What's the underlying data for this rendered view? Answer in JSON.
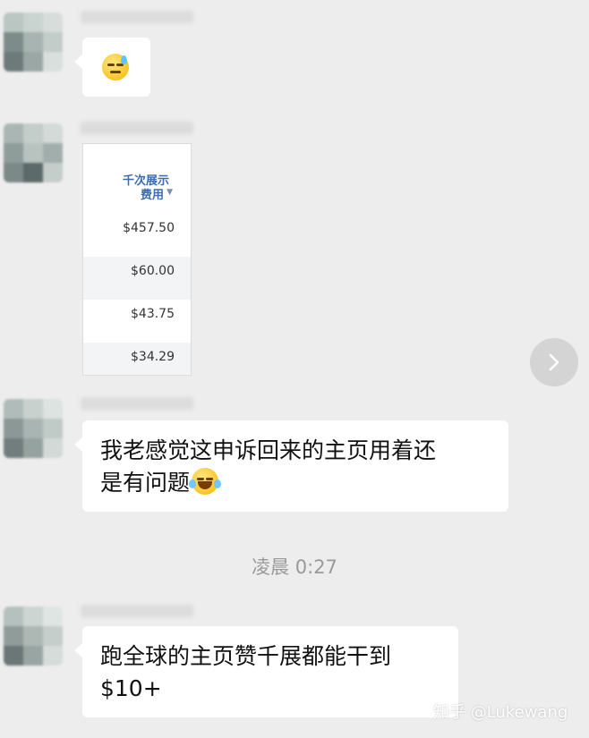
{
  "messages": [
    {
      "type": "emoji",
      "emoji": "sweat-face"
    },
    {
      "type": "image",
      "table": {
        "header_line1": "千次展示",
        "header_line2": "费用",
        "rows": [
          "$457.50",
          "$60.00",
          "$43.75",
          "$34.29"
        ]
      }
    },
    {
      "type": "text",
      "line1": "我老感觉这申诉回来的主页用着还",
      "line2": "是有问题",
      "emoji": "laughing-crying-face"
    },
    {
      "type": "text",
      "line1": "跑全球的主页赞千展都能干到",
      "line2": "$10+"
    }
  ],
  "timestamp": "凌晨 0:27",
  "watermark": "知乎 @Lukewang",
  "colors": {
    "background": "#ededed",
    "bubble": "#ffffff",
    "link_blue": "#3b6cb0",
    "timestamp": "#9a9a9a"
  }
}
